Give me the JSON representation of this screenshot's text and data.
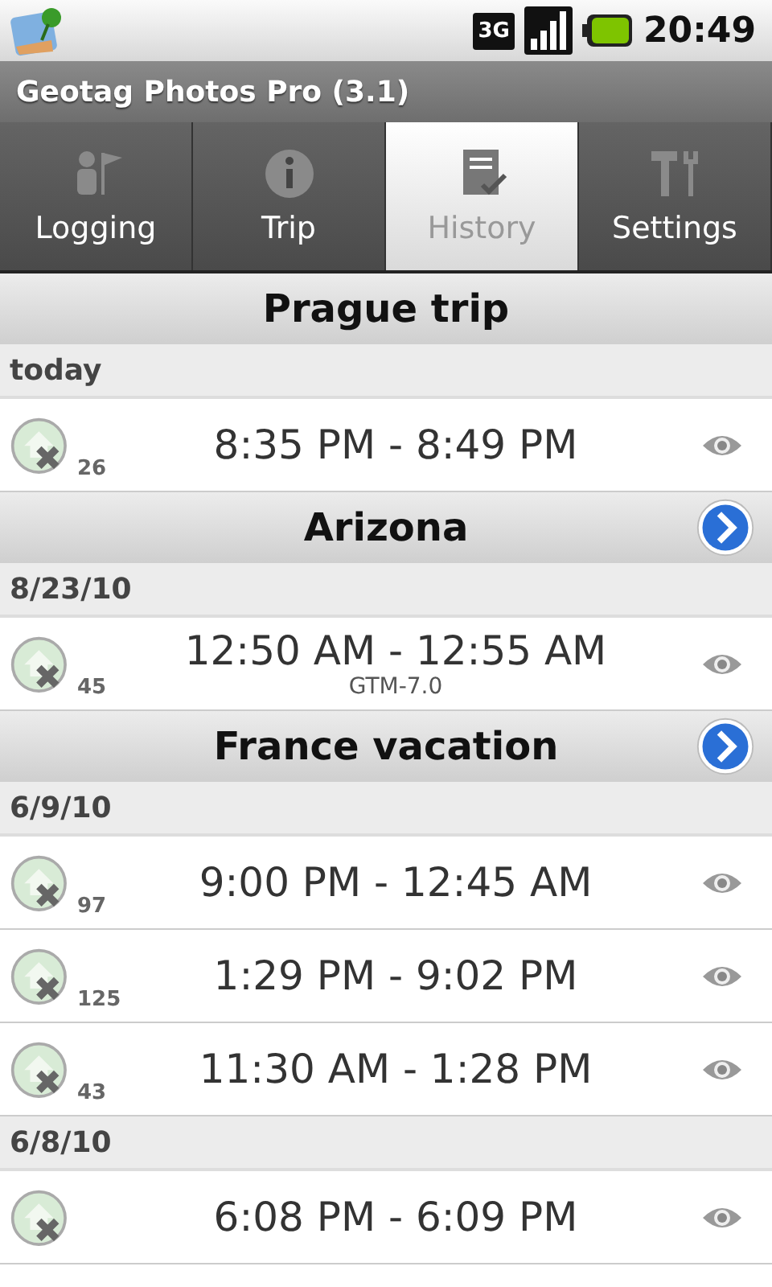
{
  "status_bar": {
    "network": "3G",
    "time": "20:49"
  },
  "app_bar": {
    "title": "Geotag Photos Pro (3.1)"
  },
  "tabs": [
    {
      "label": "Logging",
      "selected": false,
      "kind": "person"
    },
    {
      "label": "Trip",
      "selected": false,
      "kind": "info"
    },
    {
      "label": "History",
      "selected": true,
      "kind": "list"
    },
    {
      "label": "Settings",
      "selected": false,
      "kind": "tools"
    }
  ],
  "trips": [
    {
      "title": "Prague trip",
      "open_button": false,
      "days": [
        {
          "date": "today",
          "sessions": [
            {
              "count": "26",
              "time_range": "8:35 PM - 8:49 PM"
            }
          ]
        }
      ]
    },
    {
      "title": "Arizona",
      "open_button": true,
      "days": [
        {
          "date": "8/23/10",
          "sessions": [
            {
              "count": "45",
              "time_range": "12:50 AM - 12:55 AM",
              "timezone": "GTM-7.0"
            }
          ]
        }
      ]
    },
    {
      "title": "France vacation",
      "open_button": true,
      "days": [
        {
          "date": "6/9/10",
          "sessions": [
            {
              "count": "97",
              "time_range": "9:00 PM - 12:45 AM"
            },
            {
              "count": "125",
              "time_range": "1:29 PM - 9:02 PM"
            },
            {
              "count": "43",
              "time_range": "11:30 AM - 1:28 PM"
            }
          ]
        },
        {
          "date": "6/8/10",
          "sessions": [
            {
              "time_range": "6:08 PM - 6:09 PM"
            }
          ]
        }
      ]
    }
  ]
}
